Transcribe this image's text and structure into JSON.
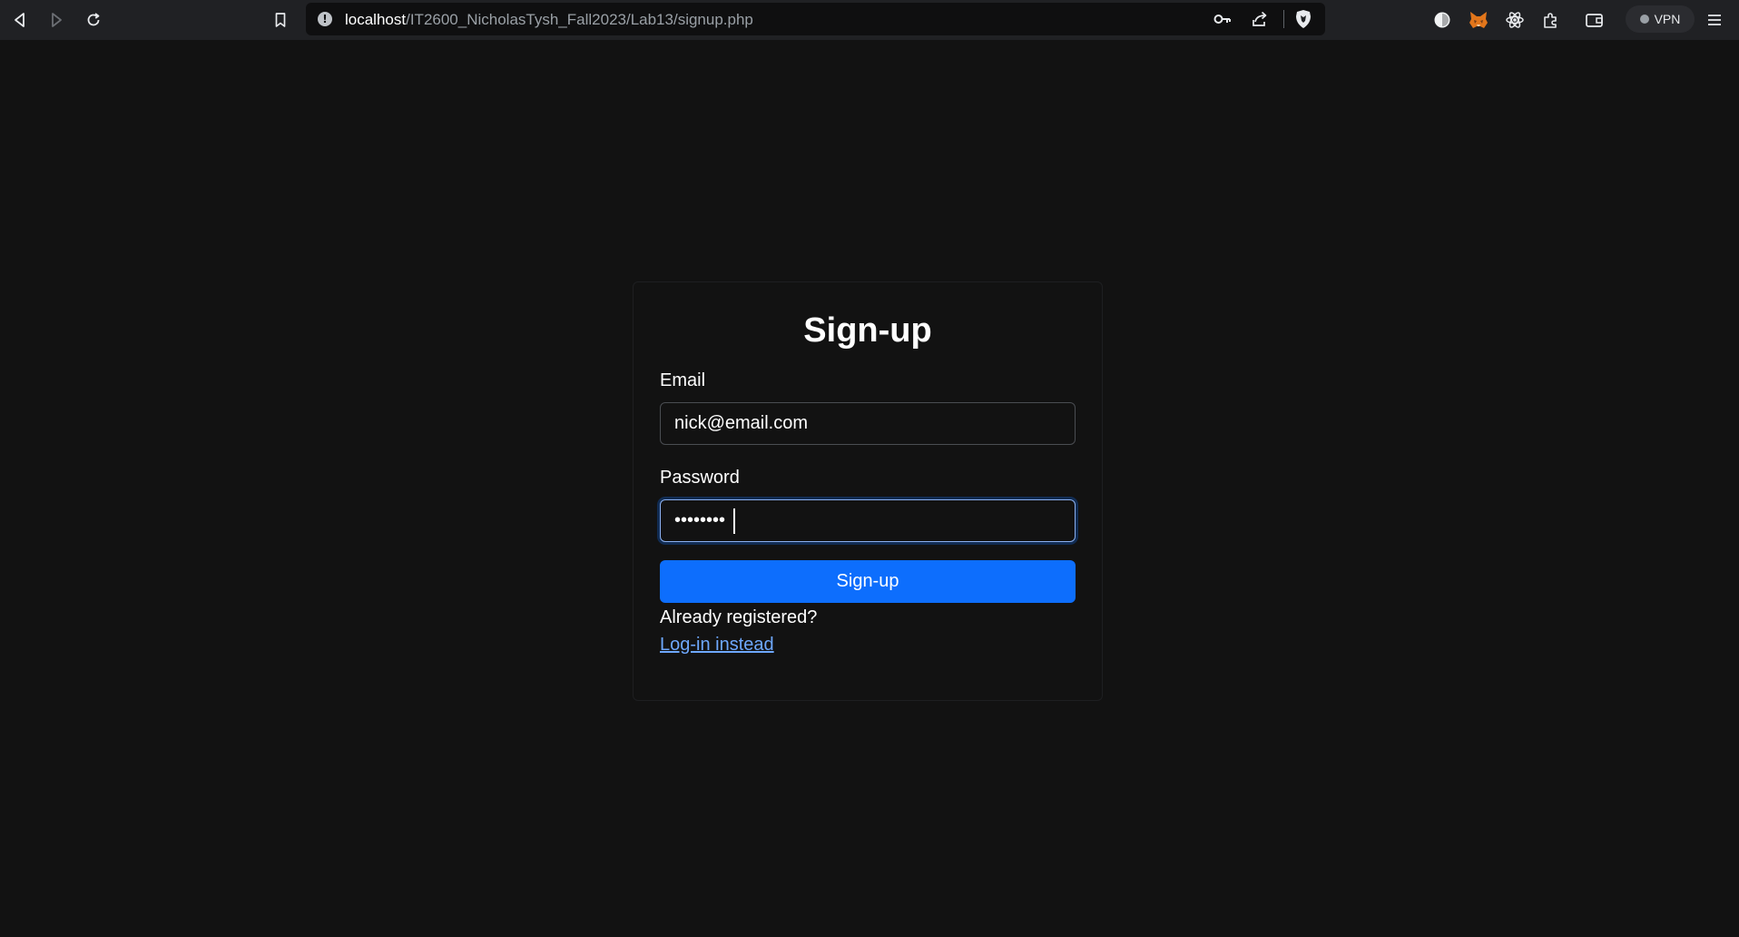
{
  "browser": {
    "url_host": "localhost",
    "url_path": "/IT2600_NicholasTysh_Fall2023/Lab13/signup.php",
    "vpn_label": "VPN",
    "icons": [
      "back-icon",
      "forward-icon",
      "reload-icon",
      "bookmark-icon",
      "site-info-icon",
      "key-icon",
      "share-icon",
      "brave-shields-icon",
      "profile-icon",
      "metamask-icon",
      "react-devtools-icon",
      "extensions-icon",
      "wallet-icon",
      "menu-icon"
    ]
  },
  "form": {
    "title": "Sign-up",
    "email_label": "Email",
    "email_value": "nick@email.com",
    "password_label": "Password",
    "password_value": "********",
    "submit_label": "Sign-up",
    "already_text": "Already registered?",
    "login_link": "Log-in instead"
  },
  "colors": {
    "background": "#121212",
    "primary_button": "#0d6efd",
    "link": "#6ea8fe"
  }
}
